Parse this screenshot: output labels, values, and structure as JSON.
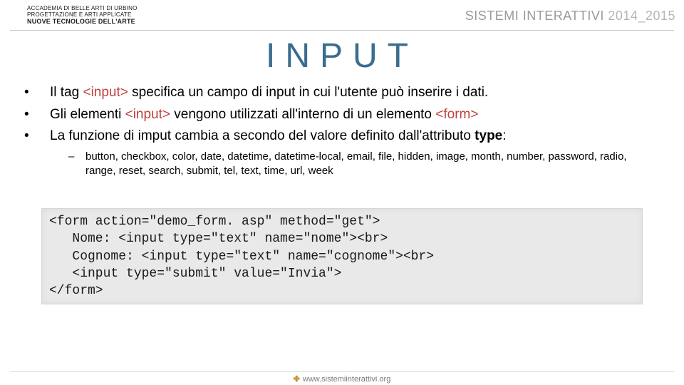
{
  "header": {
    "left_line1": "ACCADEMIA DI BELLE ARTI DI URBINO",
    "left_line2": "Progettazione e Arti applicate",
    "left_line3": "NUOVE TECNOLOGIE DELL'ARTE",
    "right_brand": "SISTEMI INTERATTIVI",
    "right_year": "2014_2015"
  },
  "title": "INPUT",
  "bullets": {
    "b1_pre": "Il tag ",
    "b1_tag": "<input>",
    "b1_post": " specifica un campo di input in cui l'utente può inserire i dati.",
    "b2_pre": "Gli elementi ",
    "b2_tag1": "<input>",
    "b2_mid": " vengono utilizzati all'interno di un elemento ",
    "b2_tag2": "<form>",
    "b3_pre": "La funzione di imput cambia a secondo del valore definito dall'attributo ",
    "b3_bold": "type",
    "b3_post": ":"
  },
  "sub": "button, checkbox, color, date, datetime, datetime-local, email, file, hidden, image, month, number, password, radio, range, reset, search, submit, tel, text, time, url, week",
  "code": "<form action=\"demo_form. asp\" method=\"get\">\n   Nome: <input type=\"text\" name=\"nome\"><br>\n   Cognome: <input type=\"text\" name=\"cognome\"><br>\n   <input type=\"submit\" value=\"Invia\">\n</form>",
  "footer": {
    "icon": "✤",
    "url": "www.sistemiinterattivi.org"
  }
}
